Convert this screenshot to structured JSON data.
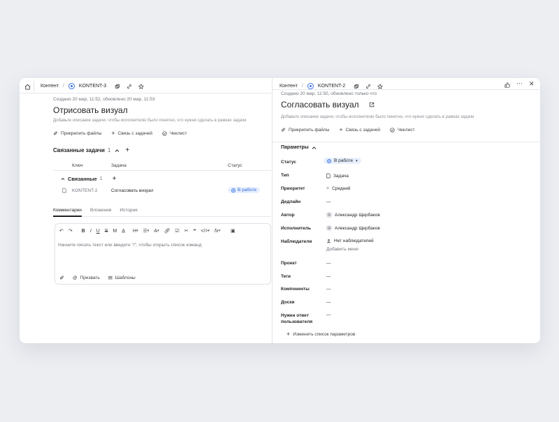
{
  "left": {
    "breadcrumb": {
      "section": "Контент",
      "separator": "/",
      "issue_key": "KONTENT-3"
    },
    "meta": "Создано 20 мар, 11:52, обновлено 20 мар, 11:53",
    "title": "Отрисовать визуал",
    "description_placeholder": "Добавьте описание задачи, чтобы исполнителю было понятно, что нужно сделать в рамках задачи",
    "actions": {
      "attach": "Прикрепить файлы",
      "link": "Связь с задачей",
      "checklist": "Чеклист"
    },
    "related": {
      "title": "Связанные задачи",
      "count": "1",
      "columns": {
        "key": "Ключ",
        "task": "Задача",
        "status": "Статус"
      },
      "group": {
        "label": "Связанные",
        "count": "1"
      },
      "rows": [
        {
          "key": "KONTENT-2",
          "task": "Согласовать визуал",
          "status": "В работе"
        }
      ]
    },
    "tabs": {
      "comments": "Комментарии",
      "attachments": "Вложения",
      "history": "История"
    },
    "editor": {
      "placeholder": "Начните писать текст или введите \"/\", чтобы открыть список команд",
      "mention": "Призвать",
      "templates": "Шаблоны",
      "toolbar": {
        "bold": "B",
        "italic": "I",
        "underline": "U",
        "strike": "S",
        "m": "M",
        "ai": "A̲",
        "heading": "H",
        "font": "A",
        "code": "</>",
        "formula": "fx"
      }
    }
  },
  "right": {
    "breadcrumb": {
      "section": "Контент",
      "separator": "/",
      "issue_key": "KONTENT-2"
    },
    "meta": "Создано 20 мар, 11:50, обновлено только что",
    "title": "Согласовать визуал",
    "description_placeholder": "Добавьте описание задачи, чтобы исполнителю было понятно, что нужно сделать в рамках задачи",
    "actions": {
      "attach": "Прикрепить файлы",
      "link": "Связь с задачей",
      "checklist": "Чеклист"
    },
    "params_title": "Параметры",
    "params": {
      "status": {
        "label": "Статус",
        "value": "В работе"
      },
      "type": {
        "label": "Тип",
        "value": "Задача"
      },
      "priority": {
        "label": "Приоритет",
        "value": "Средний"
      },
      "deadline": {
        "label": "Дедлайн",
        "value": "—"
      },
      "author": {
        "label": "Автор",
        "value": "Александр Щербаков"
      },
      "assignee": {
        "label": "Исполнитель",
        "value": "Александр Щербаков"
      },
      "watchers": {
        "label": "Наблюдатели",
        "value": "Нет наблюдателей",
        "add": "Добавить меня"
      },
      "project": {
        "label": "Проект",
        "value": "—"
      },
      "tags": {
        "label": "Теги",
        "value": "—"
      },
      "components": {
        "label": "Компоненты",
        "value": "—"
      },
      "boards": {
        "label": "Доски",
        "value": "—"
      },
      "reply": {
        "label_1": "Нужен ответ",
        "label_2": "пользователя",
        "value": "—"
      }
    },
    "edit_params": "Изменить список параметров"
  },
  "colors": {
    "accent": "#3c74e6",
    "status_bg": "#e8f0fe",
    "page_bg": "#eceef2"
  }
}
